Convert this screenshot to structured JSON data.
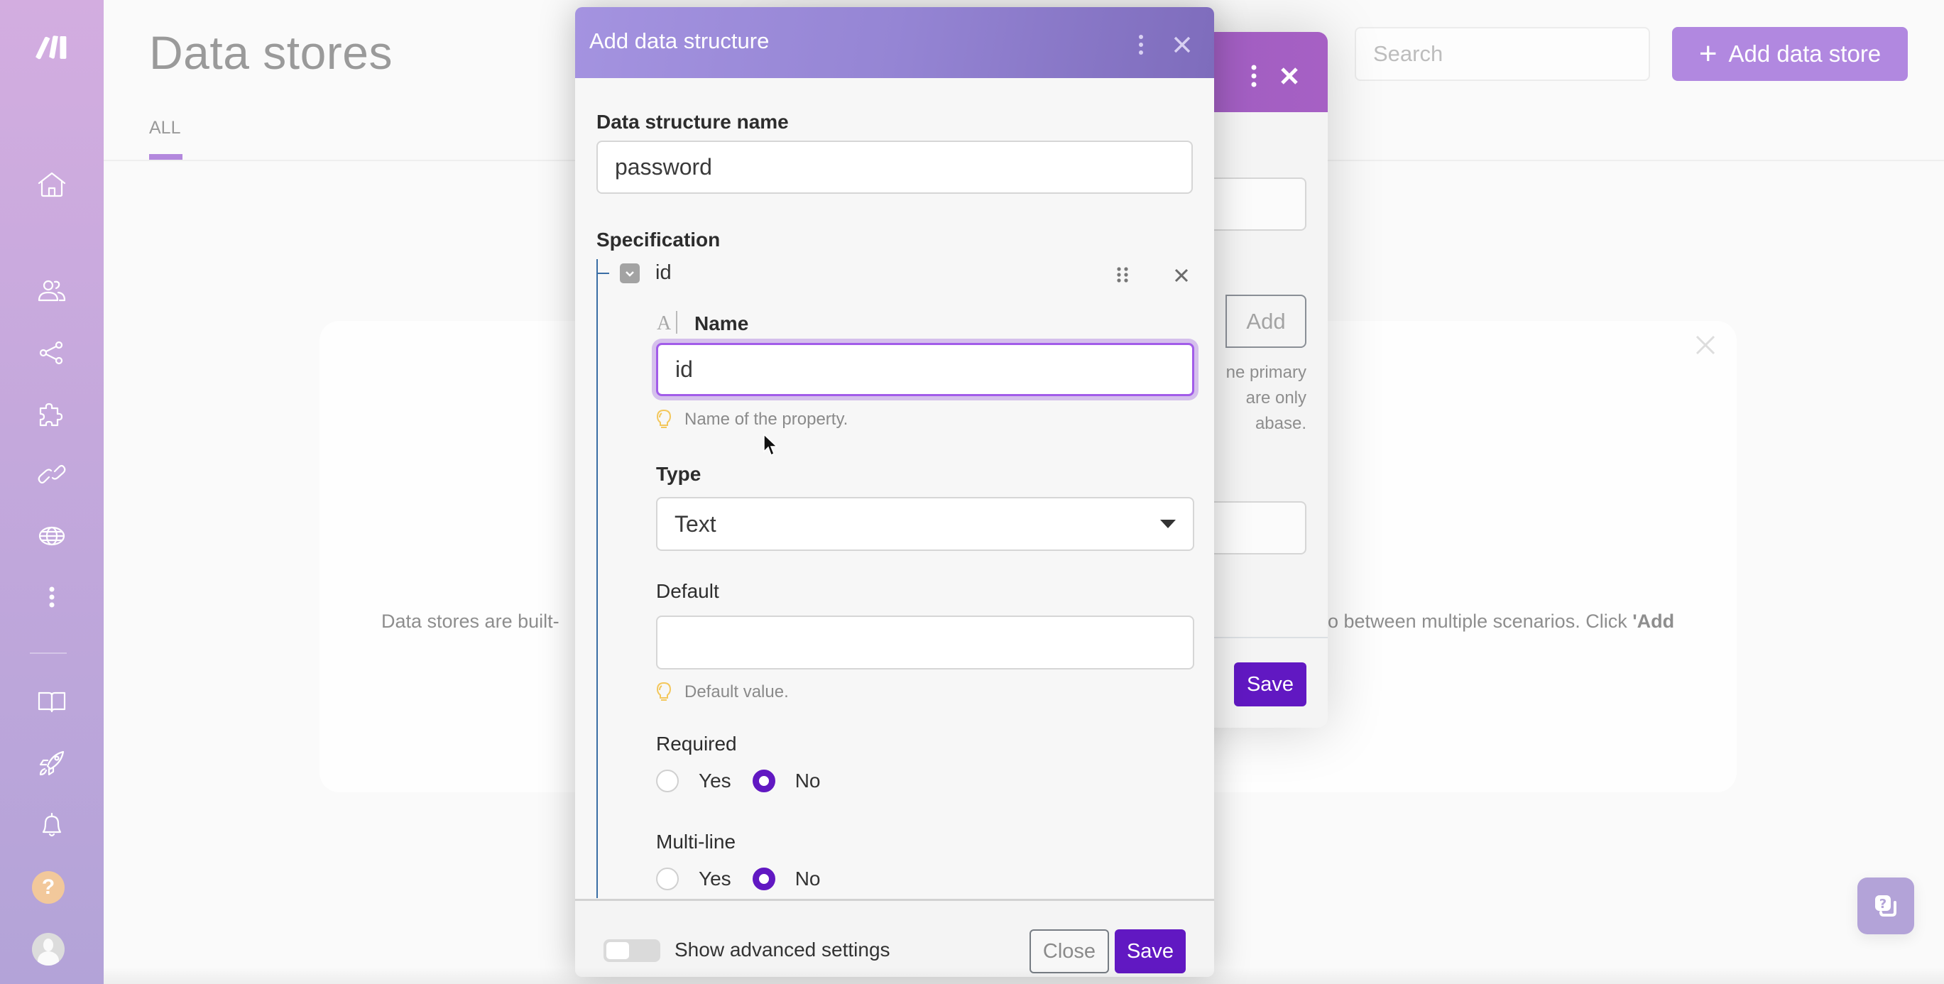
{
  "sidebar": {
    "items": [
      {
        "icon": "home-icon",
        "label": "Home"
      },
      {
        "icon": "users-icon",
        "label": "Team"
      },
      {
        "icon": "share-icon",
        "label": "Scenarios"
      },
      {
        "icon": "puzzle-icon",
        "label": "Apps"
      },
      {
        "icon": "link-icon",
        "label": "Connections"
      },
      {
        "icon": "globe-icon",
        "label": "Webhooks"
      },
      {
        "icon": "more-icon",
        "label": "More"
      }
    ],
    "bottom_items": [
      {
        "icon": "book-icon",
        "label": "Resources"
      },
      {
        "icon": "rocket-icon",
        "label": "Release notes"
      },
      {
        "icon": "bell-icon",
        "label": "Notifications"
      }
    ],
    "help_glyph": "?"
  },
  "header": {
    "title": "Data stores",
    "tabs": [
      {
        "label": "ALL",
        "active": true
      }
    ],
    "search": {
      "placeholder": "Search",
      "value": ""
    },
    "add_button": {
      "label": "Add data store",
      "icon": "plus-icon"
    }
  },
  "empty_state": {
    "text_before": "Data stores are built-",
    "text_middle": "o between multiple scenarios. Click ",
    "text_bold": "'Add"
  },
  "background_modal": {
    "add_label": "Add",
    "help_lines": [
      "ne primary",
      "are only",
      "abase."
    ],
    "save_label": "Save"
  },
  "modal": {
    "title": "Add data structure",
    "name_label": "Data structure name",
    "name_value": "password",
    "specification_label": "Specification",
    "item": {
      "name": "id",
      "name_field": {
        "type_glyph": "A",
        "label": "Name",
        "value": "id",
        "hint": "Name of the property."
      },
      "type_field": {
        "label": "Type",
        "value": "Text"
      },
      "default_field": {
        "label": "Default",
        "value": "",
        "hint": "Default value."
      },
      "required": {
        "label": "Required",
        "options": [
          "Yes",
          "No"
        ],
        "selected": "No"
      },
      "multiline": {
        "label": "Multi-line",
        "options": [
          "Yes",
          "No"
        ],
        "selected": "No"
      }
    },
    "footer": {
      "advanced_label": "Show advanced settings",
      "advanced_on": false,
      "close_label": "Close",
      "save_label": "Save"
    }
  },
  "colors": {
    "primary": "#6118c2",
    "accent": "#b188e0",
    "focus": "#a25ce9",
    "sidebar_top": "#d3ade0",
    "sidebar_bottom": "#b3a3d8"
  }
}
